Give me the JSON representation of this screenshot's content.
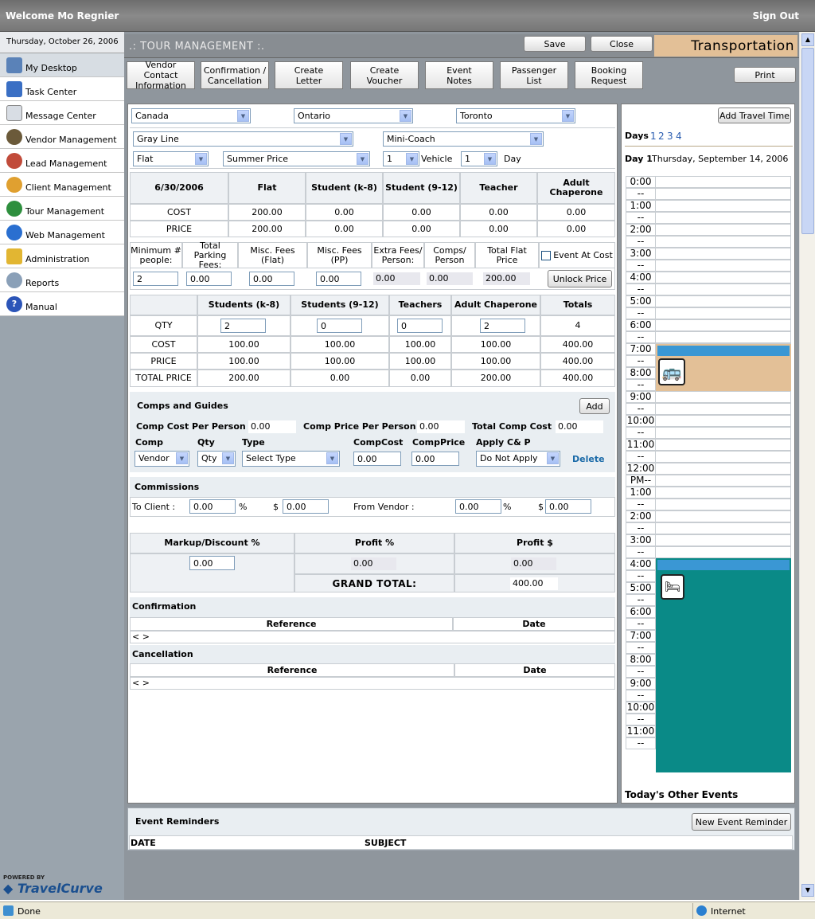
{
  "header": {
    "welcome": "Welcome Mo Regnier",
    "signout": "Sign Out"
  },
  "sidebar": {
    "date": "Thursday, October 26, 2006",
    "items": [
      {
        "label": "My Desktop"
      },
      {
        "label": "Task Center"
      },
      {
        "label": "Message Center"
      },
      {
        "label": "Vendor Management"
      },
      {
        "label": "Lead Management"
      },
      {
        "label": "Client Management"
      },
      {
        "label": "Tour Management"
      },
      {
        "label": "Web Management"
      },
      {
        "label": "Administration"
      },
      {
        "label": "Reports"
      },
      {
        "label": "Manual"
      }
    ],
    "powered": "POWERED BY",
    "brand": "TravelCurve"
  },
  "title": {
    "section": ".: TOUR MANAGEMENT :.",
    "save": "Save",
    "close": "Close",
    "category": "Transportation"
  },
  "toolbar": {
    "vendor_contact": [
      "Vendor Contact",
      "Information"
    ],
    "confirmation": [
      "Confirmation /",
      "Cancellation"
    ],
    "create_letter": [
      "Create",
      "Letter"
    ],
    "create_voucher": [
      "Create",
      "Voucher"
    ],
    "event_notes": [
      "Event",
      "Notes"
    ],
    "passenger_list": [
      "Passenger",
      "List"
    ],
    "booking_request": [
      "Booking",
      "Request"
    ],
    "print": "Print"
  },
  "location": {
    "country": "Canada",
    "province": "Ontario",
    "city": "Toronto"
  },
  "vendor": {
    "name": "Gray Line",
    "vehicle_type": "Mini-Coach",
    "rate_type": "Flat",
    "season": "Summer Price",
    "vehicle_qty": "1",
    "vehicle_label": "Vehicle",
    "day_qty": "1",
    "day_label": "Day"
  },
  "pricing": {
    "date": "6/30/2006",
    "headers": [
      "Flat",
      "Student (k-8)",
      "Student (9-12)",
      "Teacher",
      "Adult Chaperone"
    ],
    "rows": [
      {
        "label": "COST",
        "values": [
          "200.00",
          "0.00",
          "0.00",
          "0.00",
          "0.00"
        ]
      },
      {
        "label": "PRICE",
        "values": [
          "200.00",
          "0.00",
          "0.00",
          "0.00",
          "0.00"
        ]
      }
    ]
  },
  "fees": {
    "headers": [
      "Minimum # people:",
      "Total Parking Fees:",
      "Misc. Fees (Flat)",
      "Misc. Fees (PP)",
      "Extra Fees/ Person:",
      "Comps/ Person",
      "Total Flat Price"
    ],
    "event_at_cost": "Event At Cost",
    "values": [
      "2",
      "0.00",
      "0.00",
      "0.00",
      "0.00",
      "0.00",
      "200.00"
    ],
    "unlock": "Unlock Price"
  },
  "qty_table": {
    "headers": [
      "Students (k-8)",
      "Students (9-12)",
      "Teachers",
      "Adult Chaperone",
      "Totals"
    ],
    "qty_label": "QTY",
    "qty": [
      "2",
      "0",
      "0",
      "2",
      "4"
    ],
    "rows": [
      {
        "label": "COST",
        "values": [
          "100.00",
          "100.00",
          "100.00",
          "100.00",
          "400.00"
        ]
      },
      {
        "label": "PRICE",
        "values": [
          "100.00",
          "100.00",
          "100.00",
          "100.00",
          "400.00"
        ]
      },
      {
        "label": "TOTAL PRICE",
        "values": [
          "200.00",
          "0.00",
          "0.00",
          "200.00",
          "400.00"
        ]
      }
    ]
  },
  "comps": {
    "title": "Comps and Guides",
    "add": "Add",
    "cost_pp_label": "Comp Cost Per Person",
    "cost_pp": "0.00",
    "price_pp_label": "Comp Price Per Person",
    "price_pp": "0.00",
    "total_label": "Total Comp Cost",
    "total": "0.00",
    "col_comp": "Comp",
    "col_qty": "Qty",
    "col_type": "Type",
    "col_cost": "CompCost",
    "col_price": "CompPrice",
    "col_apply": "Apply C& P",
    "comp": "Vendor",
    "qty": "Qty",
    "type": "Select Type",
    "cost": "0.00",
    "price": "0.00",
    "apply": "Do Not Apply",
    "delete": "Delete"
  },
  "commissions": {
    "title": "Commissions",
    "to_client": "To Client :",
    "to_client_pct": "0.00",
    "pct": "%",
    "dollar": "$",
    "to_client_amt": "0.00",
    "from_vendor": "From Vendor :",
    "from_vendor_pct": "0.00",
    "from_vendor_amt": "0.00"
  },
  "profit": {
    "markup_label": "Markup/Discount %",
    "profit_pct_label": "Profit %",
    "profit_amt_label": "Profit $",
    "markup": "0.00",
    "profit_pct": "0.00",
    "profit_amt": "0.00",
    "grand_label": "GRAND  TOTAL:",
    "grand": "400.00"
  },
  "confirmation": {
    "title": "Confirmation",
    "ref": "Reference",
    "date": "Date",
    "empty": "< >"
  },
  "cancellation": {
    "title": "Cancellation",
    "ref": "Reference",
    "date": "Date",
    "empty": "< >"
  },
  "reminders": {
    "title": "Event Reminders",
    "new": "New Event Reminder",
    "col_date": "DATE",
    "col_subject": "SUBJECT"
  },
  "calendar": {
    "add_travel": "Add Travel Time",
    "days_label": "Days",
    "days": [
      "1",
      "2",
      "3",
      "4"
    ],
    "day_title": "Day 1",
    "day_date": "Thursday, September 14, 2006",
    "other_events": "Today's Other Events",
    "times": [
      "0:00",
      "--",
      "1:00",
      "--",
      "2:00",
      "--",
      "3:00",
      "--",
      "4:00",
      "--",
      "5:00",
      "--",
      "6:00",
      "--",
      "7:00",
      "--",
      "8:00",
      "--",
      "9:00",
      "--",
      "10:00",
      "--",
      "11:00",
      "--",
      "12:00",
      "PM--",
      "1:00",
      "--",
      "2:00",
      "--",
      "3:00",
      "--",
      "4:00",
      "--",
      "5:00",
      "--",
      "6:00",
      "--",
      "7:00",
      "--",
      "8:00",
      "--",
      "9:00",
      "--",
      "10:00",
      "--",
      "11:00",
      "--"
    ],
    "event_colors": {
      "transport": "#e3c097",
      "hotel": "#0a8a87",
      "bar": "#3a97d4"
    }
  },
  "status": {
    "done": "Done",
    "zone": "Internet"
  }
}
